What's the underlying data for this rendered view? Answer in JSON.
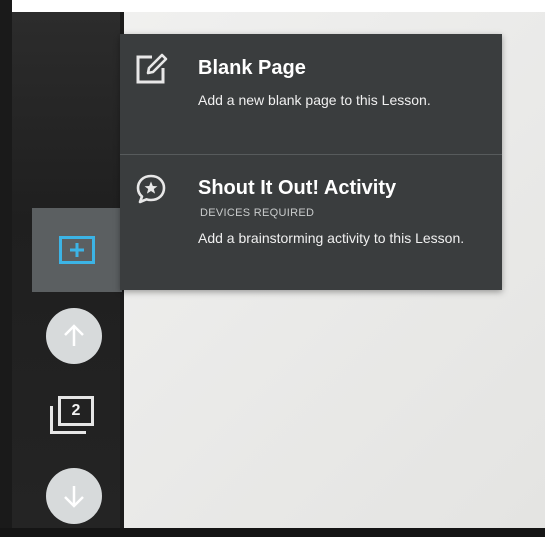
{
  "menu": {
    "items": [
      {
        "title": "Blank Page",
        "tag": "",
        "description": "Add a new blank page to this Lesson.",
        "icon": "edit-page-icon"
      },
      {
        "title": "Shout It Out! Activity",
        "tag": "DEVICES REQUIRED",
        "description": "Add a brainstorming activity to this Lesson.",
        "icon": "speech-star-icon"
      }
    ]
  },
  "sidebar": {
    "add_icon": "add-box-icon",
    "up_icon": "arrow-up-icon",
    "down_icon": "arrow-down-icon",
    "page_count": "2"
  },
  "colors": {
    "menu_bg": "#3a3d3e",
    "sidebar_bg": "#242424",
    "active_tile": "#5b5f61",
    "accent_blue": "#3cb4e6"
  }
}
